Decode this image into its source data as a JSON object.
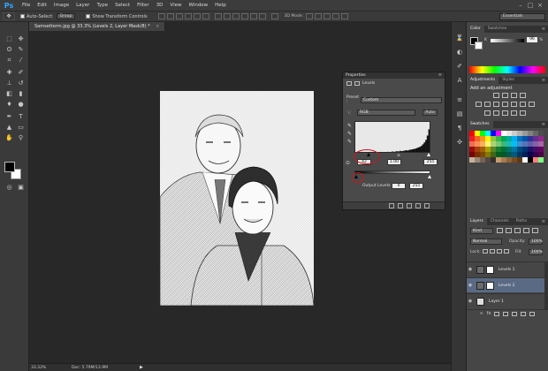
{
  "app": {
    "logo": "Ps"
  },
  "menu": [
    "File",
    "Edit",
    "Image",
    "Layer",
    "Type",
    "Select",
    "Filter",
    "3D",
    "View",
    "Window",
    "Help"
  ],
  "window_controls": [
    "–",
    "□",
    "×"
  ],
  "options_bar": {
    "auto_select_label": "Auto-Select:",
    "auto_select_value": "Group",
    "show_transform_label": "Show Transform Controls",
    "mode_3d_label": "3D Mode:",
    "workspace": "Essentials"
  },
  "document": {
    "tab_title": "Samsetterm.jpg @ 33.3% (Levels 2, Layer Mask/8) *",
    "tab_close": "×",
    "zoom": "33.33%",
    "doc_size": "Doc: 5.79M/13.9M"
  },
  "properties": {
    "panel_title": "Properties",
    "header_label": "Levels",
    "preset_label": "Preset :",
    "preset_value": "Custom",
    "channel_value": "RGB",
    "auto_label": "Auto",
    "input_black": "42",
    "input_gamma": "1.00",
    "input_white": "255",
    "output_label": "Output Levels:",
    "output_black": "0",
    "output_white": "255",
    "histogram_values": [
      1,
      1,
      1,
      2,
      1,
      2,
      2,
      2,
      3,
      2,
      3,
      3,
      3,
      4,
      3,
      4,
      4,
      5,
      4,
      5,
      5,
      6,
      5,
      6,
      7,
      6,
      7,
      8,
      7,
      9,
      8,
      9,
      10,
      11,
      10,
      12,
      13,
      14,
      15,
      16,
      18,
      20,
      22,
      25,
      30,
      36,
      44,
      58,
      78,
      96
    ]
  },
  "dock_icons": [
    "history-icon",
    "color-panel-icon",
    "brush-icon",
    "text-icon",
    "adjust-icon",
    "layers-mini-icon",
    "paragraph-icon",
    "character-icon"
  ],
  "color_panel": {
    "tabs": [
      "Color",
      "Swatches"
    ],
    "slider_label": "K",
    "value": "96",
    "unit": "%"
  },
  "adjustments_panel": {
    "tabs": [
      "Adjustments",
      "Styles"
    ],
    "heading": "Add an adjustment"
  },
  "swatches": {
    "tab": "Swatches",
    "colors": [
      "#ff0000",
      "#ffff00",
      "#00ff00",
      "#00ffff",
      "#0000ff",
      "#ff00ff",
      "#ffffff",
      "#e6e6e6",
      "#cccccc",
      "#b3b3b3",
      "#999999",
      "#808080",
      "#666666",
      "#4d4d4d",
      "#ee1d24",
      "#f26522",
      "#f7941d",
      "#fff200",
      "#8dc63f",
      "#39b54a",
      "#00a651",
      "#00a99d",
      "#00aeef",
      "#0072bc",
      "#0054a6",
      "#2e3192",
      "#662d91",
      "#92278f",
      "#f26c4f",
      "#f68e56",
      "#fbaf5d",
      "#fff568",
      "#acd373",
      "#7cc576",
      "#3cb878",
      "#1cbbb4",
      "#00bff3",
      "#448ccb",
      "#5674b9",
      "#605ca8",
      "#8560a8",
      "#a864a8",
      "#9e0b0f",
      "#a0410d",
      "#a36209",
      "#aba000",
      "#598527",
      "#197b30",
      "#007236",
      "#00746b",
      "#0076a3",
      "#004a80",
      "#003471",
      "#1b1464",
      "#440e62",
      "#630460",
      "#790000",
      "#7b2e00",
      "#7d4900",
      "#827b00",
      "#406618",
      "#005e20",
      "#005826",
      "#005952",
      "#005b7f",
      "#003663",
      "#002157",
      "#0d004c",
      "#32004b",
      "#4b0049",
      "#c7b299",
      "#998675",
      "#736357",
      "#534741",
      "#37302d",
      "#c69c6d",
      "#a67c52",
      "#8c6239",
      "#754c24",
      "#603913",
      "#ffffff",
      "#000000",
      "#ff8080",
      "#80ff80"
    ]
  },
  "layers_panel": {
    "tabs": [
      "Layers",
      "Channels",
      "Paths"
    ],
    "kind_label": "Kind",
    "blend_mode": "Normal",
    "opacity_label": "Opacity:",
    "opacity_value": "100%",
    "lock_label": "Lock:",
    "fill_label": "Fill:",
    "fill_value": "100%",
    "layers": [
      {
        "name": "Levels 1",
        "selected": false,
        "bg": false
      },
      {
        "name": "Levels 2",
        "selected": true,
        "bg": false
      },
      {
        "name": "Layer 1",
        "selected": false,
        "bg": true
      }
    ]
  }
}
